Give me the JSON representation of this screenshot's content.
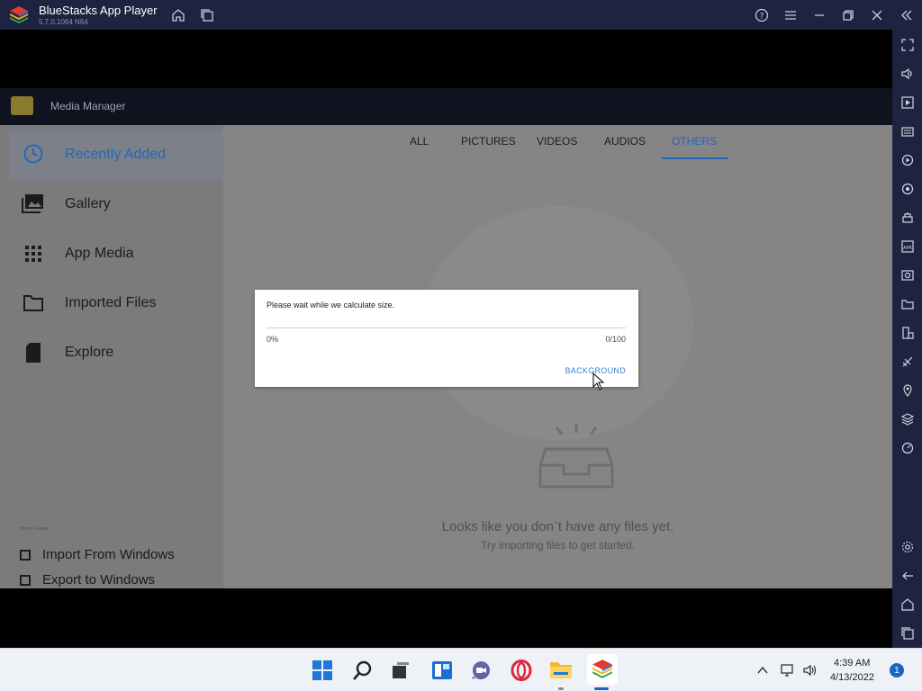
{
  "window": {
    "title": "BlueStacks App Player",
    "version": "5.7.0.1064  N64"
  },
  "titlebar_icons": [
    "home-icon",
    "multi-instance-icon",
    "help-icon",
    "menu-icon",
    "minimize-icon",
    "restore-icon",
    "close-icon",
    "collapse-sidebar-icon"
  ],
  "right_sidebar_icons": [
    "fullscreen-icon",
    "volume-icon",
    "media-icon",
    "keyboard-icon",
    "macro-icon",
    "rotate-icon",
    "multi-instance-manager-icon",
    "apk-icon",
    "screenshot-icon",
    "folder-icon",
    "shake-icon",
    "eco-mode-icon",
    "location-icon",
    "layers-icon",
    "speed-icon",
    "settings-icon",
    "back-icon",
    "android-home-icon",
    "recent-apps-icon"
  ],
  "media_manager": {
    "title": "Media Manager",
    "nav": {
      "recently_added": "Recently Added",
      "gallery": "Gallery",
      "app_media": "App Media",
      "imported_files": "Imported Files",
      "explore": "Explore"
    },
    "import_section_label": "Import / Export",
    "import_from_windows": "Import From Windows",
    "export_to_windows": "Export to Windows",
    "tabs": {
      "all": "ALL",
      "pictures": "PICTURES",
      "videos": "VIDEOS",
      "audios": "AUDIOS",
      "others": "OTHERS"
    },
    "active_tab": "OTHERS",
    "empty_title": "Looks like you don`t have any files yet.",
    "empty_subtitle": "Try importing files to get started."
  },
  "dialog": {
    "message": "Please wait while we calculate size.",
    "percent": "0%",
    "count": "0/100",
    "progress": 0,
    "background_button": "BACKGROUND"
  },
  "taskbar": {
    "time": "4:39 AM",
    "date": "4/13/2022",
    "notification_count": "1"
  },
  "colors": {
    "accent": "#2466b8",
    "titlebar": "#1d2340",
    "dialog_button": "#3b87c8"
  }
}
